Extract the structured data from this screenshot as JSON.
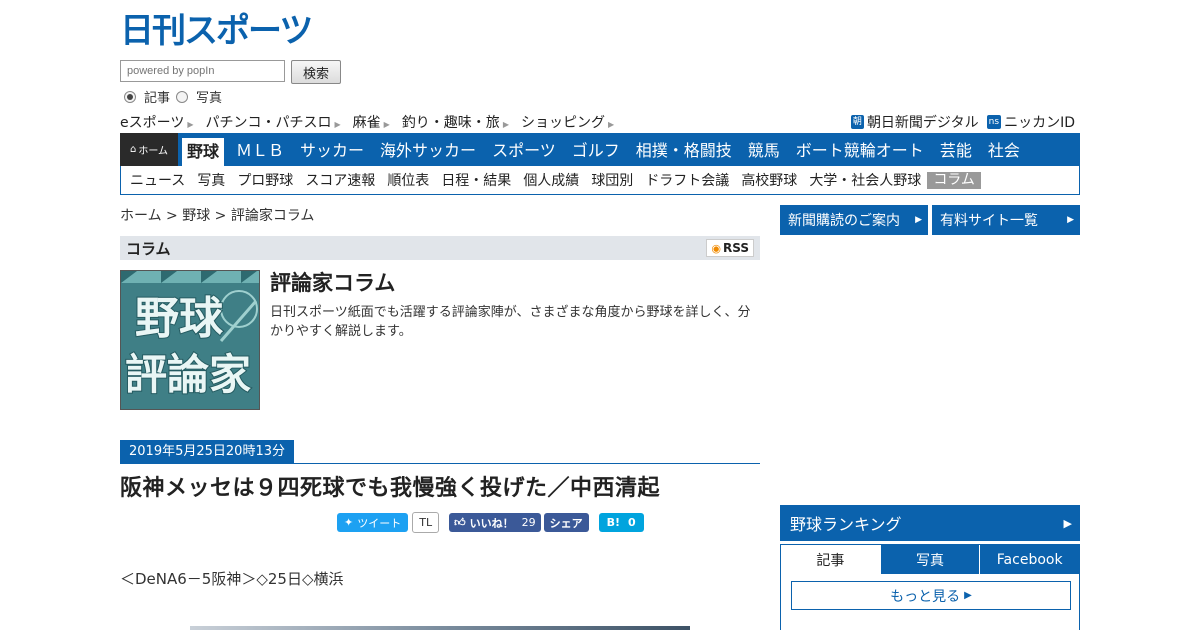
{
  "header": {
    "logo_text": "日刊スポーツ",
    "search": {
      "placeholder": "powered by popIn",
      "button_label": "検索",
      "radio_options": [
        {
          "label": "記事",
          "selected": true
        },
        {
          "label": "写真",
          "selected": false
        }
      ]
    },
    "quick_links": [
      "eスポーツ",
      "パチンコ・パチスロ",
      "麻雀",
      "釣り・趣味・旅",
      "ショッピング"
    ],
    "right_links": [
      {
        "badge": "朝",
        "label": "朝日新聞デジタル"
      },
      {
        "badge": "ns",
        "label": "ニッカンID"
      }
    ]
  },
  "main_nav": {
    "home_label": "ホーム",
    "items": [
      {
        "label": "野球",
        "active": true
      },
      {
        "label": "ＭＬＢ",
        "active": false
      },
      {
        "label": "サッカー",
        "active": false
      },
      {
        "label": "海外サッカー",
        "active": false
      },
      {
        "label": "スポーツ",
        "active": false
      },
      {
        "label": "ゴルフ",
        "active": false
      },
      {
        "label": "相撲・格闘技",
        "active": false
      },
      {
        "label": "競馬",
        "active": false
      },
      {
        "label": "ボート競輪オート",
        "active": false
      },
      {
        "label": "芸能",
        "active": false
      },
      {
        "label": "社会",
        "active": false
      }
    ]
  },
  "sub_nav": {
    "items": [
      {
        "label": "ニュース",
        "active": false
      },
      {
        "label": "写真",
        "active": false
      },
      {
        "label": "プロ野球",
        "active": false
      },
      {
        "label": "スコア速報",
        "active": false
      },
      {
        "label": "順位表",
        "active": false
      },
      {
        "label": "日程・結果",
        "active": false
      },
      {
        "label": "個人成績",
        "active": false
      },
      {
        "label": "球団別",
        "active": false
      },
      {
        "label": "ドラフト会議",
        "active": false
      },
      {
        "label": "高校野球",
        "active": false
      },
      {
        "label": "大学・社会人野球",
        "active": false
      },
      {
        "label": "コラム",
        "active": true
      }
    ]
  },
  "breadcrumb": "ホーム > 野球 > 評論家コラム",
  "section": {
    "title": "コラム",
    "rss_label": "RSS"
  },
  "column": {
    "image_text_line1": "野球",
    "image_text_line2": "評論家",
    "title": "評論家コラム",
    "description": "日刊スポーツ紙面でも活躍する評論家陣が、さまざまな角度から野球を詳しく、分かりやすく解説します。"
  },
  "article": {
    "date": "2019年5月25日20時13分",
    "headline": "阪神メッセは９四死球でも我慢強く投げた／中西清起",
    "game_info": "＜DeNA6－5阪神＞◇25日◇横浜"
  },
  "social": {
    "tweet_label": "ツイート",
    "tl_label": "TL",
    "like_label": "いいね！",
    "like_count": "29",
    "share_label": "シェア",
    "hatena_label": "B!",
    "hatena_count": "0"
  },
  "sidebar": {
    "buttons": [
      "新聞購読のご案内",
      "有料サイト一覧"
    ],
    "ranking_title": "野球ランキング",
    "ranking_tabs": [
      {
        "label": "記事",
        "active": true
      },
      {
        "label": "写真",
        "active": false
      },
      {
        "label": "Facebook",
        "active": false
      }
    ],
    "more_label": "もっと見る"
  },
  "colors": {
    "brand_blue": "#0b62ad",
    "twitter": "#1da1f2",
    "facebook": "#3b5998",
    "hatena": "#00a4de"
  }
}
